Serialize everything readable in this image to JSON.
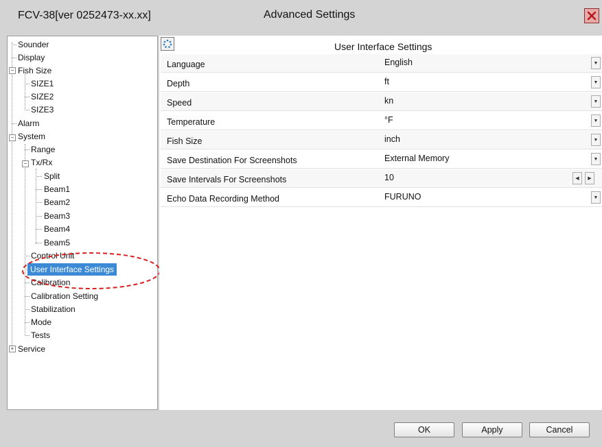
{
  "window": {
    "app_title": "FCV-38[ver 0252473-xx.xx]",
    "dialog_title": "Advanced Settings",
    "close_icon": "close-icon",
    "close_color": "#e9a9a9"
  },
  "tree": {
    "items": [
      {
        "label": "Sounder"
      },
      {
        "label": "Display"
      },
      {
        "label": "Fish Size"
      },
      {
        "label": "SIZE1"
      },
      {
        "label": "SIZE2"
      },
      {
        "label": "SIZE3"
      },
      {
        "label": "Alarm"
      },
      {
        "label": "System"
      },
      {
        "label": "Range"
      },
      {
        "label": "Tx/Rx"
      },
      {
        "label": "Split"
      },
      {
        "label": "Beam1"
      },
      {
        "label": "Beam2"
      },
      {
        "label": "Beam3"
      },
      {
        "label": "Beam4"
      },
      {
        "label": "Beam5"
      },
      {
        "label": "Control Unit"
      },
      {
        "label": "User Interface Settings",
        "selected": true
      },
      {
        "label": "Calibration"
      },
      {
        "label": "Calibration Setting"
      },
      {
        "label": "Stabilization"
      },
      {
        "label": "Mode"
      },
      {
        "label": "Tests"
      },
      {
        "label": "Service"
      }
    ],
    "selected_color": "#3c8ad6",
    "highlight_color": "#d62020"
  },
  "panel": {
    "title": "User Interface Settings",
    "refresh_icon": "refresh-icon",
    "settings": [
      {
        "name": "Language",
        "value": "English",
        "control": "dropdown"
      },
      {
        "name": "Depth",
        "value": "ft",
        "control": "dropdown"
      },
      {
        "name": "Speed",
        "value": "kn",
        "control": "dropdown"
      },
      {
        "name": "Temperature",
        "value": "°F",
        "control": "dropdown"
      },
      {
        "name": "Fish Size",
        "value": "inch",
        "control": "dropdown"
      },
      {
        "name": "Save Destination For Screenshots",
        "value": "External Memory",
        "control": "dropdown"
      },
      {
        "name": "Save Intervals For Screenshots",
        "value": "10",
        "control": "spinner"
      },
      {
        "name": "Echo Data Recording Method",
        "value": "FURUNO",
        "control": "dropdown"
      }
    ]
  },
  "footer": {
    "ok_label": "OK",
    "apply_label": "Apply",
    "cancel_label": "Cancel"
  }
}
